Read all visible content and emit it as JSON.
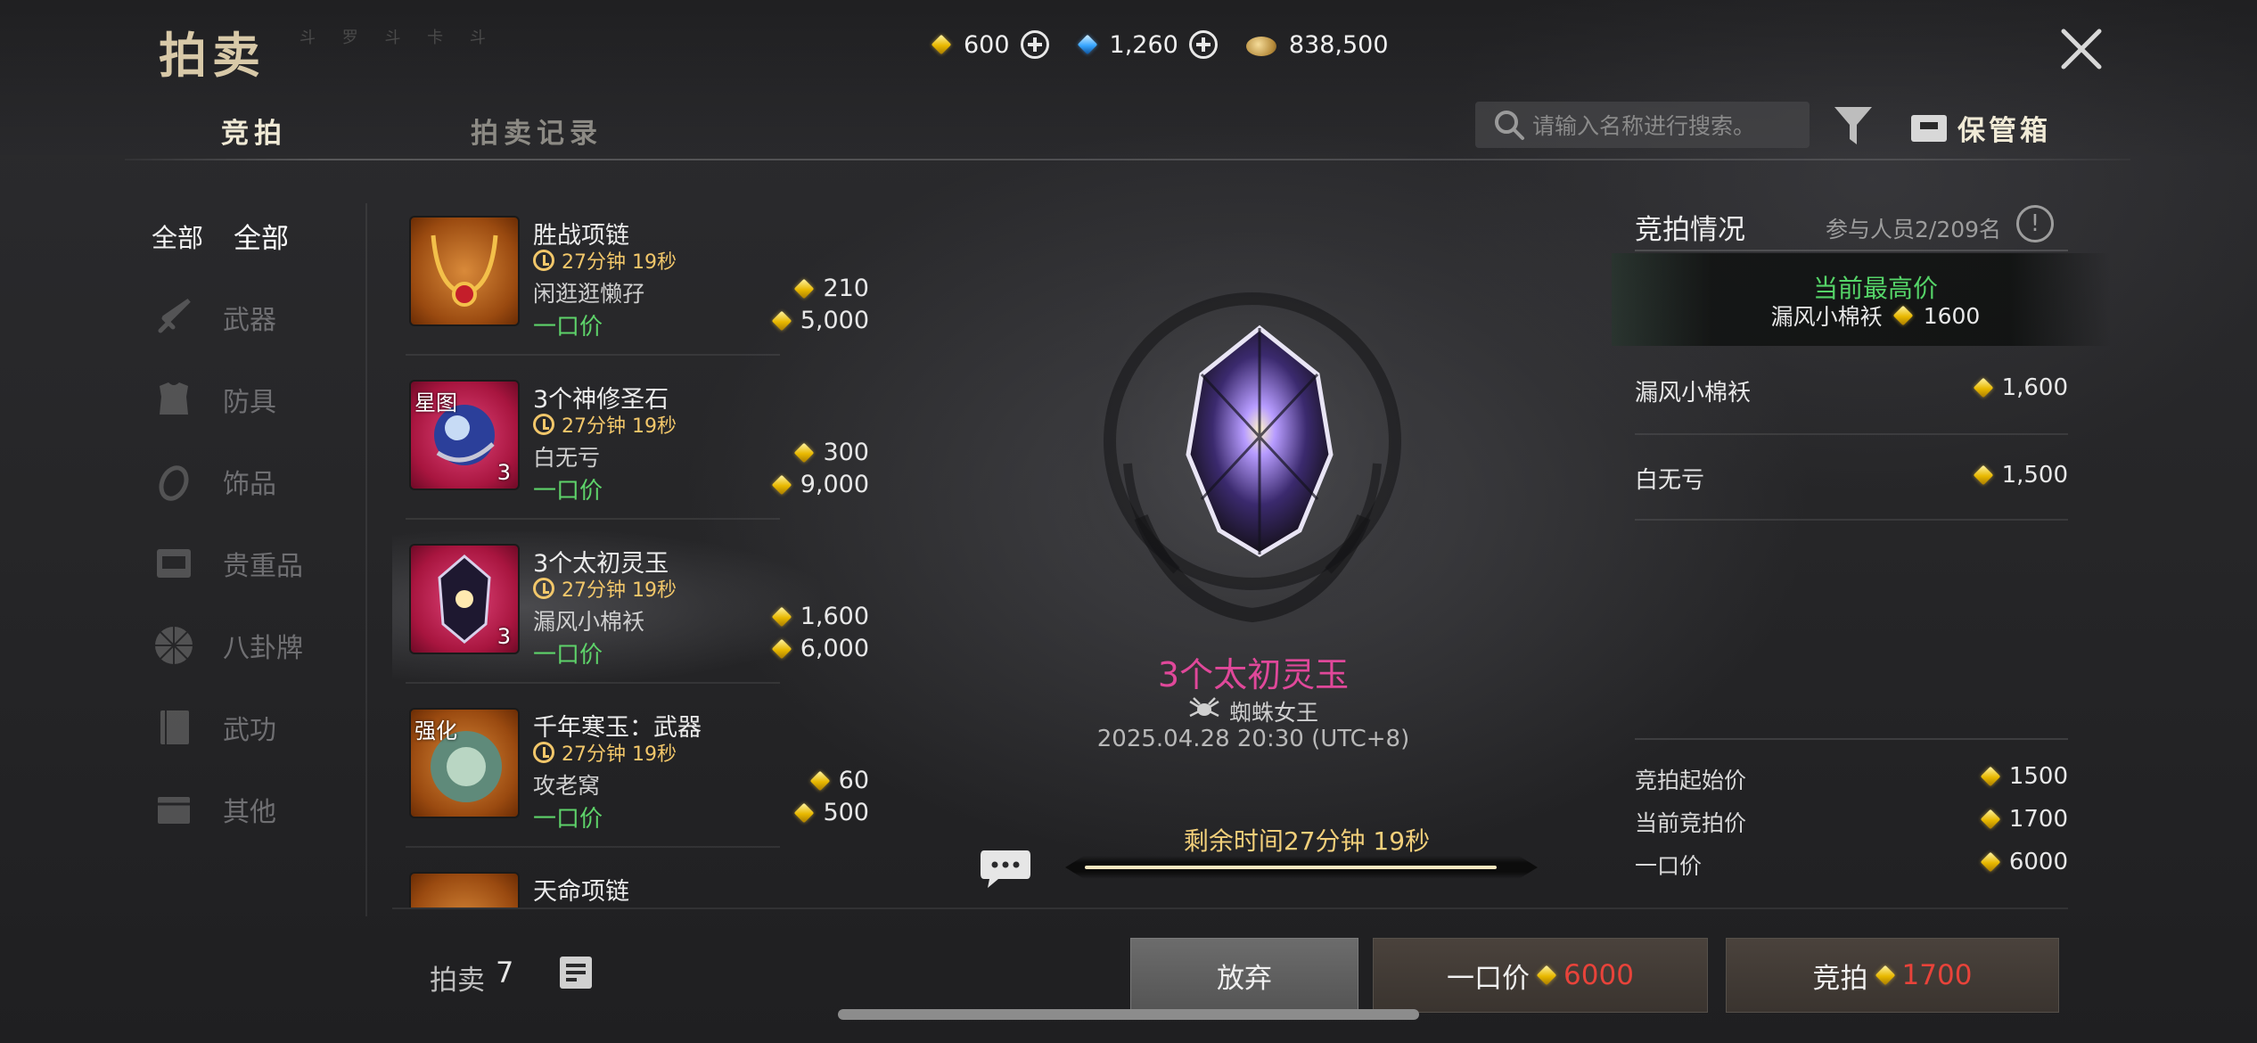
{
  "header": {
    "title": "拍卖",
    "title_sub": "斗 罗 斗 卡 斗",
    "currency": [
      {
        "icon": "gold-ingot-icon",
        "value": "600"
      },
      {
        "icon": "blue-gem-icon",
        "value": "1,260"
      },
      {
        "icon": "coin-pile-icon",
        "value": "838,500"
      }
    ],
    "close_icon": "close-icon"
  },
  "tabs": [
    {
      "label": "竞拍",
      "active": true
    },
    {
      "label": "拍卖记录",
      "active": false
    }
  ],
  "search": {
    "placeholder": "请输入名称进行搜索。"
  },
  "storage_label": "保管箱",
  "categories": [
    {
      "tag": "全部",
      "label": "全部",
      "icon": null
    },
    {
      "label": "武器",
      "icon": "sword-icon"
    },
    {
      "label": "防具",
      "icon": "armor-icon"
    },
    {
      "label": "饰品",
      "icon": "ring-icon"
    },
    {
      "label": "贵重品",
      "icon": "chest-icon"
    },
    {
      "label": "八卦牌",
      "icon": "bagua-icon"
    },
    {
      "label": "武功",
      "icon": "book-icon"
    },
    {
      "label": "其他",
      "icon": "box-icon"
    }
  ],
  "items": [
    {
      "name": "胜战项链",
      "time": "27分钟 19秒",
      "bidder": "闲逛逛懒孖",
      "bid": "210",
      "bo_label": "一口价",
      "buyout": "5,000",
      "tag": "",
      "qty": ""
    },
    {
      "name": "3个神修圣石",
      "time": "27分钟 19秒",
      "bidder": "白无亏",
      "bid": "300",
      "bo_label": "一口价",
      "buyout": "9,000",
      "tag": "星图",
      "qty": "3"
    },
    {
      "name": "3个太初灵玉",
      "time": "27分钟 19秒",
      "bidder": "漏风小棉袄",
      "bid": "1,600",
      "bo_label": "一口价",
      "buyout": "6,000",
      "tag": "",
      "qty": "3"
    },
    {
      "name": "千年寒玉：武器",
      "time": "27分钟 19秒",
      "bidder": "攻老窝",
      "bid": "60",
      "bo_label": "一口价",
      "buyout": "500",
      "tag": "强化",
      "qty": ""
    },
    {
      "name": "天命项链",
      "time": "",
      "bidder": "",
      "bid": "",
      "bo_label": "",
      "buyout": "",
      "tag": "",
      "qty": ""
    }
  ],
  "footer": {
    "count_label": "拍卖",
    "count": "7"
  },
  "detail": {
    "name": "3个太初灵玉",
    "seller": "蜘蛛女王",
    "datetime": "2025.04.28 20:30 (UTC+8)",
    "remaining": "剩余时间27分钟 19秒",
    "remaining_fraction": 0.95
  },
  "bid_info": {
    "title": "竞拍情况",
    "participants": "参与人员2/209名",
    "highest_label": "当前最高价",
    "highest_bidder": "漏风小棉袄",
    "highest_value": "1600",
    "history": [
      {
        "name": "漏风小棉袄",
        "value": "1,600"
      },
      {
        "name": "白无亏",
        "value": "1,500"
      }
    ],
    "summary": [
      {
        "label": "竞拍起始价",
        "value": "1500"
      },
      {
        "label": "当前竞拍价",
        "value": "1700"
      },
      {
        "label": "一口价",
        "value": "6000"
      }
    ]
  },
  "actions": {
    "giveup": "放弃",
    "buyout_label": "一口价",
    "buyout_value": "6000",
    "bid_label": "竞拍",
    "bid_value": "1700",
    "price_color": "#e8433a"
  }
}
